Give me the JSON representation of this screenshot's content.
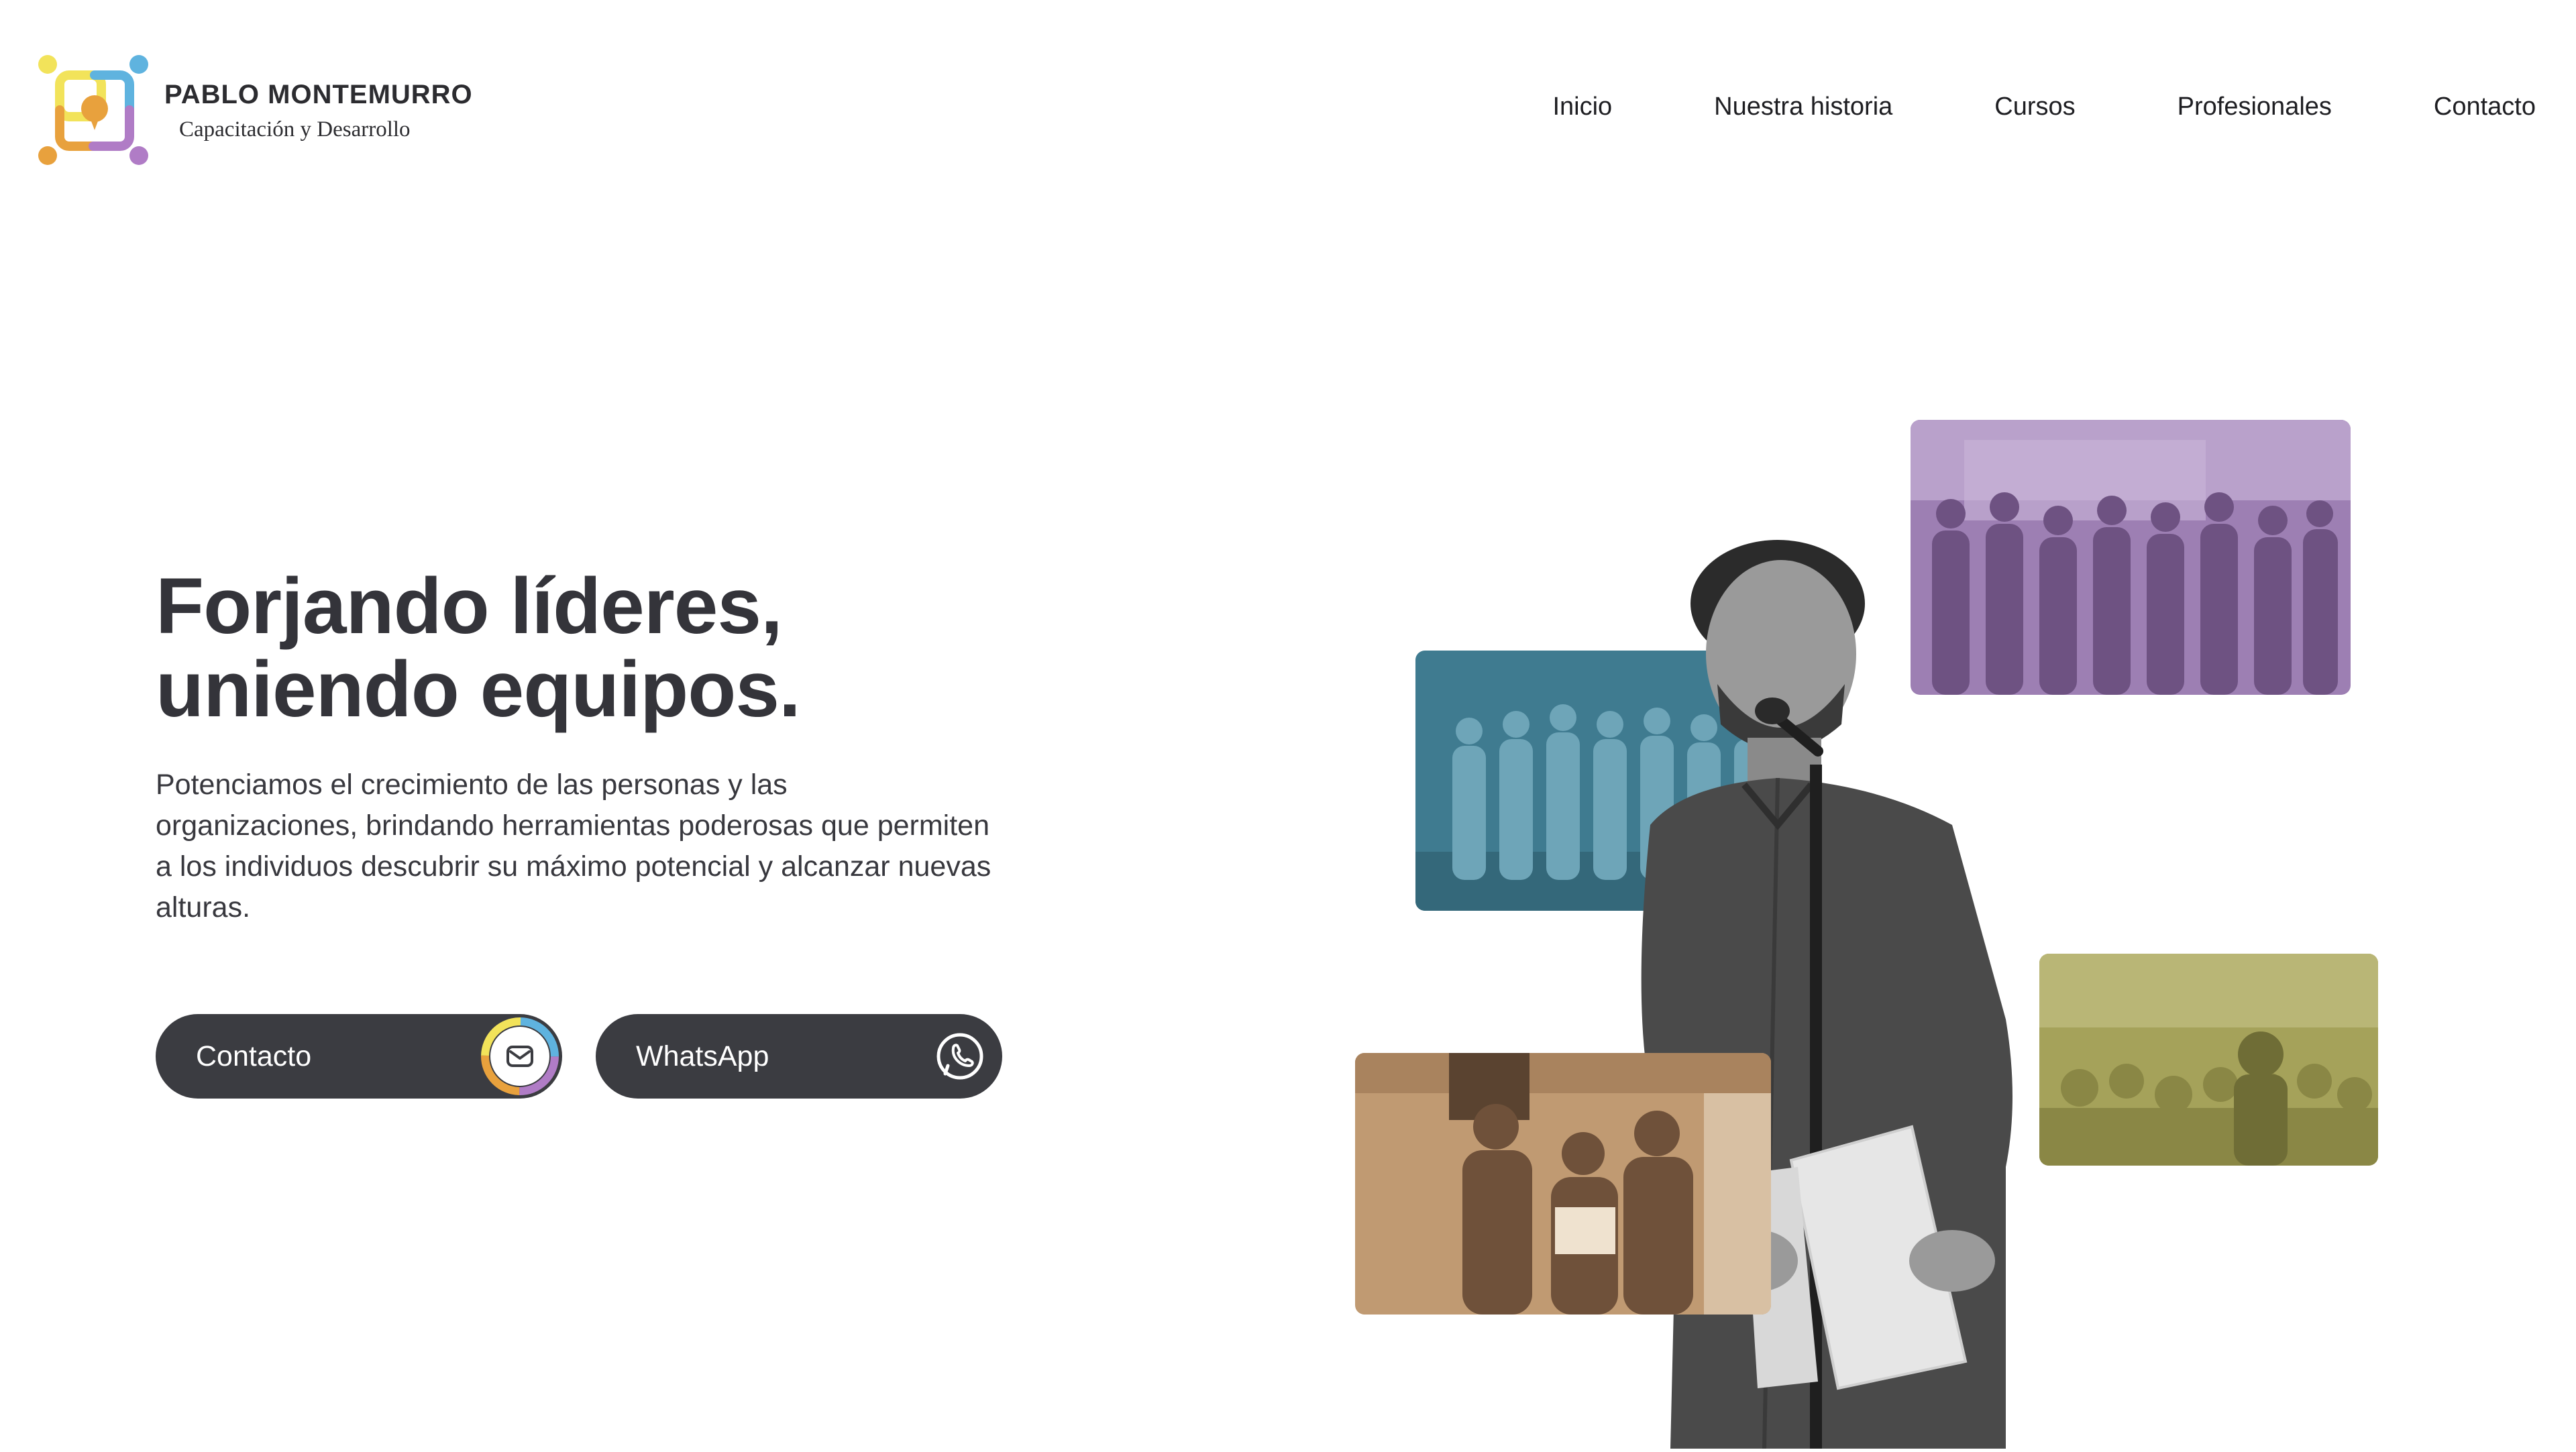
{
  "brand": {
    "name": "PABLO MONTEMURRO",
    "subtitle": "Capacitación y Desarrollo",
    "colors": {
      "yellow": "#f2e35a",
      "blue": "#5fb3df",
      "orange": "#e8a13d",
      "purple": "#b07cc6"
    }
  },
  "nav": {
    "items": [
      {
        "label": "Inicio"
      },
      {
        "label": "Nuestra historia"
      },
      {
        "label": "Cursos"
      },
      {
        "label": "Profesionales"
      },
      {
        "label": "Contacto"
      }
    ]
  },
  "hero": {
    "title": "Forjando líderes, uniendo equipos.",
    "description": "Potenciamos el crecimiento de las personas y las organizaciones, brindando herramientas poderosas que permiten a los individuos descubrir su máximo potencial y alcanzar nuevas alturas.",
    "buttons": {
      "contact": {
        "label": "Contacto",
        "icon": "mail-icon"
      },
      "whatsapp": {
        "label": "WhatsApp",
        "icon": "whatsapp-icon"
      }
    },
    "button_color": "#3b3c41"
  },
  "collage": {
    "photos": [
      {
        "name": "group-photo-purple",
        "tint": "#9d7fb3"
      },
      {
        "name": "group-photo-teal",
        "tint": "#3f7b90"
      },
      {
        "name": "audience-photo-olive",
        "tint": "#a5a25a"
      },
      {
        "name": "award-photo-tan",
        "tint": "#c09a72"
      },
      {
        "name": "speaker-photo",
        "tint": "#5a5a5a"
      }
    ]
  }
}
